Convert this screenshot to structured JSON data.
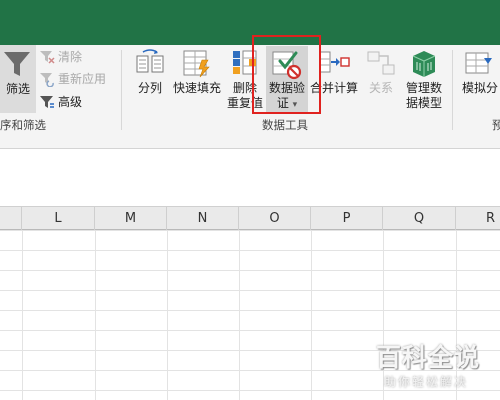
{
  "sort_filter": {
    "filter_label": "筛选",
    "clear_label": "清除",
    "reapply_label": "重新应用",
    "advanced_label": "高级",
    "group_label": "序和筛选"
  },
  "data_tools": {
    "text_to_columns": "分列",
    "flash_fill": "快速填充",
    "remove_duplicates_line1": "删除",
    "remove_duplicates_line2": "重复值",
    "data_validation_line1": "数据验",
    "data_validation_line2": "证",
    "data_validation_arrow": "▾",
    "consolidate": "合并计算",
    "relationships": "关系",
    "manage_model_line1": "管理数",
    "manage_model_line2": "据模型",
    "group_label": "数据工具"
  },
  "forecast": {
    "what_if_label": "模拟分",
    "group_label_partial": "预"
  },
  "columns": [
    "L",
    "M",
    "N",
    "O",
    "P",
    "Q",
    "R"
  ],
  "watermark": {
    "brand": "百科全说",
    "slogan": "助你轻松解决"
  },
  "colors": {
    "title_bar": "#217346",
    "highlight_border": "#e0221f",
    "ribbon_bg": "#f4f4f4"
  }
}
